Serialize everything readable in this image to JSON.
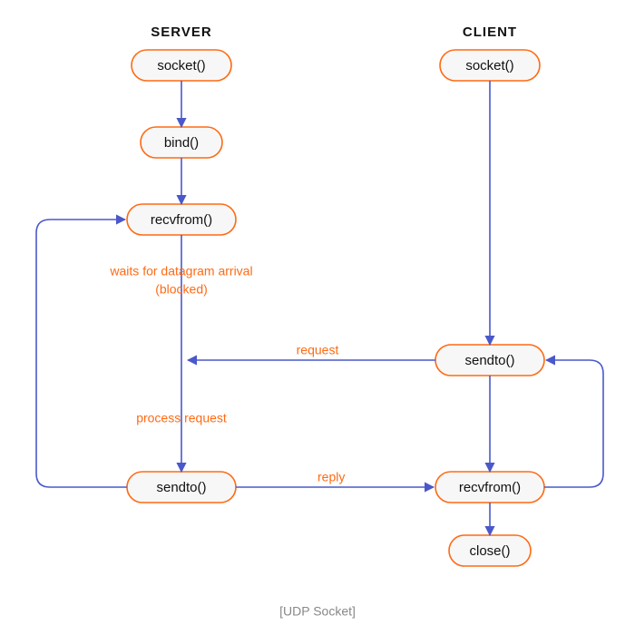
{
  "diagram": {
    "caption": "[UDP Socket]",
    "headers": {
      "server": "SERVER",
      "client": "CLIENT"
    },
    "nodes": {
      "server_socket": "socket()",
      "server_bind": "bind()",
      "server_recv": "recvfrom()",
      "server_send": "sendto()",
      "client_socket": "socket()",
      "client_send": "sendto()",
      "client_recv": "recvfrom()",
      "client_close": "close()"
    },
    "labels": {
      "waits1": "waits for datagram arrival",
      "waits2": "(blocked)",
      "process": "process request",
      "request": "request",
      "reply": "reply"
    },
    "colors": {
      "node_stroke": "#ff6a13",
      "node_fill": "#f7f7f7",
      "edge": "#4a58c9",
      "label": "#ff6a13"
    }
  }
}
